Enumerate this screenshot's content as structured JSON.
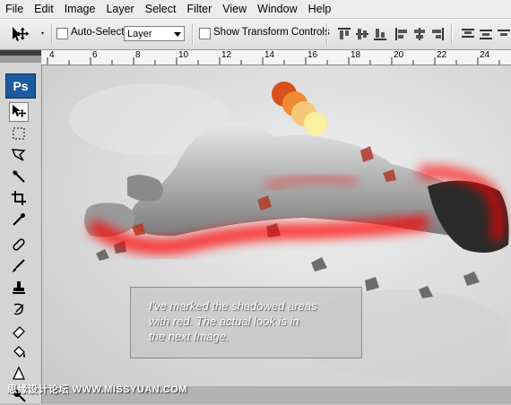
{
  "menu": [
    "File",
    "Edit",
    "Image",
    "Layer",
    "Select",
    "Filter",
    "View",
    "Window",
    "Help"
  ],
  "options": {
    "auto_select_label": "Auto-Select:",
    "auto_select_value": "Layer",
    "transform_label": "Show Transform Controls"
  },
  "toolbox": {
    "logo": "Ps",
    "tools": [
      "move-tool-icon",
      "marquee-tool-icon",
      "lasso-tool-icon",
      "quick-select-tool-icon",
      "crop-tool-icon",
      "eyedropper-tool-icon",
      "healing-brush-tool-icon",
      "brush-tool-icon",
      "clone-stamp-tool-icon",
      "history-brush-tool-icon",
      "eraser-tool-icon",
      "paint-bucket-tool-icon",
      "blur-tool-icon",
      "dodge-tool-icon"
    ]
  },
  "ruler": {
    "ticks": [
      "4",
      "6",
      "8",
      "10",
      "12",
      "14",
      "16",
      "18",
      "20",
      "22",
      "24"
    ]
  },
  "canvas": {
    "caption_line1": "I've marked the shadowed areas",
    "caption_line2": "with red. The actual look  is in",
    "caption_line3": "the next Image.",
    "watermark": "思缘设计论坛 WWW.MISSYUAN.COM"
  },
  "colors": {
    "swatch1": "#d8501c",
    "swatch2": "#f08a30",
    "swatch3": "#f4c878",
    "swatch4": "#f8f2a0",
    "shadow_red": "#ff0000"
  }
}
